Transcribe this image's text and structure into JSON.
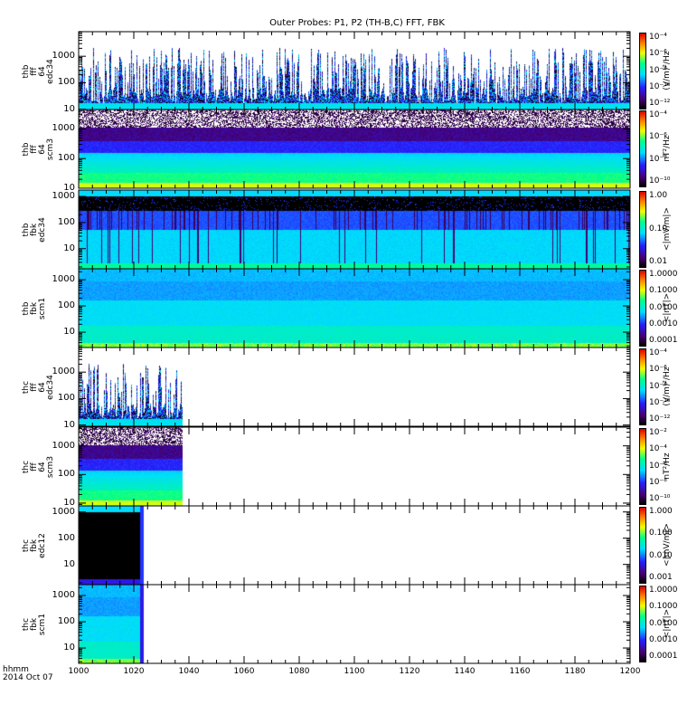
{
  "title": "Outer Probes: P1, P2 (TH-B,C) FFT, FBK",
  "footer": {
    "line1": "hhmm",
    "line2": "2014 Oct 07"
  },
  "chart_data": {
    "type": "heatmap",
    "title": "Outer Probes: P1, P2 (TH-B,C) FFT, FBK",
    "xlabel": "hhmm",
    "xlim": [
      1000,
      1200
    ],
    "xticks": [
      "1000",
      "1020",
      "1040",
      "1060",
      "1080",
      "1100",
      "1120",
      "1140",
      "1160",
      "1180",
      "1200"
    ],
    "panels": [
      {
        "label": [
          "thb",
          "fff",
          "64",
          "edc34"
        ],
        "kind": "fff_e",
        "ylim": [
          9,
          8500
        ],
        "yticks": [
          "10",
          "100",
          "1000"
        ],
        "cbar_ticks": [
          "10⁻⁴",
          "10⁻⁶",
          "10⁻⁸",
          "10⁻¹⁰",
          "10⁻¹²"
        ],
        "cbar_unit": "(V/m)²/Hz",
        "data_end": 1200
      },
      {
        "label": [
          "thb",
          "fff",
          "64",
          "scm3"
        ],
        "kind": "fff_b",
        "ylim": [
          10,
          4500
        ],
        "yticks": [
          "10",
          "100",
          "1000"
        ],
        "cbar_ticks": [
          "10⁻⁴",
          "10⁻⁶",
          "10⁻⁸",
          "10⁻¹⁰"
        ],
        "cbar_unit": "nT²/Hz",
        "data_end": 1200
      },
      {
        "label": [
          "thb",
          "fbk",
          "edc34"
        ],
        "kind": "fbk_e",
        "ylim": [
          1.7,
          1750
        ],
        "yticks": [
          "10",
          "100",
          "1000"
        ],
        "cbar_ticks": [
          "1.00",
          "0.10",
          "0.01"
        ],
        "cbar_unit": "<|mV/m|>",
        "data_end": 1200
      },
      {
        "label": [
          "thb",
          "fbk",
          "scm1"
        ],
        "kind": "fbk_b",
        "ylim": [
          2.6,
          2600
        ],
        "yticks": [
          "10",
          "100",
          "1000"
        ],
        "cbar_ticks": [
          "1.0000",
          "0.1000",
          "0.0100",
          "0.0010",
          "0.0001"
        ],
        "cbar_unit": "<|nT|>",
        "data_end": 1200
      },
      {
        "label": [
          "thc",
          "fff",
          "64",
          "edc34"
        ],
        "kind": "fff_e",
        "ylim": [
          9,
          8500
        ],
        "yticks": [
          "10",
          "100",
          "1000"
        ],
        "cbar_ticks": [
          "10⁻⁴",
          "10⁻⁶",
          "10⁻⁸",
          "10⁻¹⁰",
          "10⁻¹²"
        ],
        "cbar_unit": "(V/m)²/Hz",
        "data_end": 1037.5
      },
      {
        "label": [
          "thc",
          "fff",
          "64",
          "scm3"
        ],
        "kind": "fff_b",
        "ylim": [
          8,
          4500
        ],
        "yticks": [
          "10",
          "100",
          "1000"
        ],
        "cbar_ticks": [
          "10⁻²",
          "10⁻⁴",
          "10⁻⁶",
          "10⁻⁸",
          "10⁻¹⁰"
        ],
        "cbar_unit": "nT²/Hz",
        "data_end": 1037.5
      },
      {
        "label": [
          "thc",
          "fbk",
          "edc12"
        ],
        "kind": "fbk_e2",
        "ylim": [
          1.7,
          1700
        ],
        "yticks": [
          "10",
          "100",
          "1000"
        ],
        "cbar_ticks": [
          "1.000",
          "0.100",
          "0.010",
          "0.001"
        ],
        "cbar_unit": "<|mV/m|>",
        "data_end": 1023.5
      },
      {
        "label": [
          "thc",
          "fbk",
          "scm1"
        ],
        "kind": "fbk_b",
        "ylim": [
          2.6,
          2600
        ],
        "yticks": [
          "10",
          "100",
          "1000"
        ],
        "cbar_ticks": [
          "1.0000",
          "0.1000",
          "0.0100",
          "0.0010",
          "0.0001"
        ],
        "cbar_unit": "<|nT|>",
        "data_end": 1023.5
      }
    ]
  }
}
